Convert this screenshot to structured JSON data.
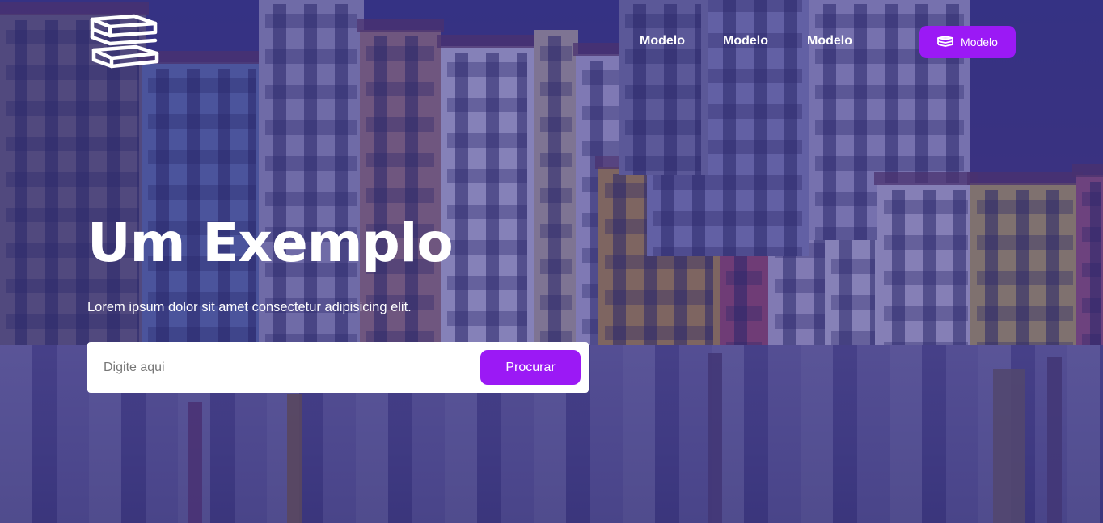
{
  "header": {
    "logo_icon": "stacked-books-icon",
    "nav": [
      {
        "label": "Modelo"
      },
      {
        "label": "Modelo"
      },
      {
        "label": "Modelo"
      }
    ],
    "cta": {
      "label": "Modelo",
      "icon": "books-icon"
    }
  },
  "hero": {
    "title": "Um Exemplo",
    "subtitle": "Lorem ipsum dolor sit amet consectetur adipisicing elit.",
    "search": {
      "placeholder": "Digite aqui",
      "value": "",
      "button_label": "Procurar"
    },
    "background_image": "harbour-town-photo"
  },
  "colors": {
    "accent": "#9b19f5",
    "overlay": "#2c2682",
    "text": "#ffffff",
    "search_bg": "#ffffff",
    "placeholder": "#777777"
  }
}
